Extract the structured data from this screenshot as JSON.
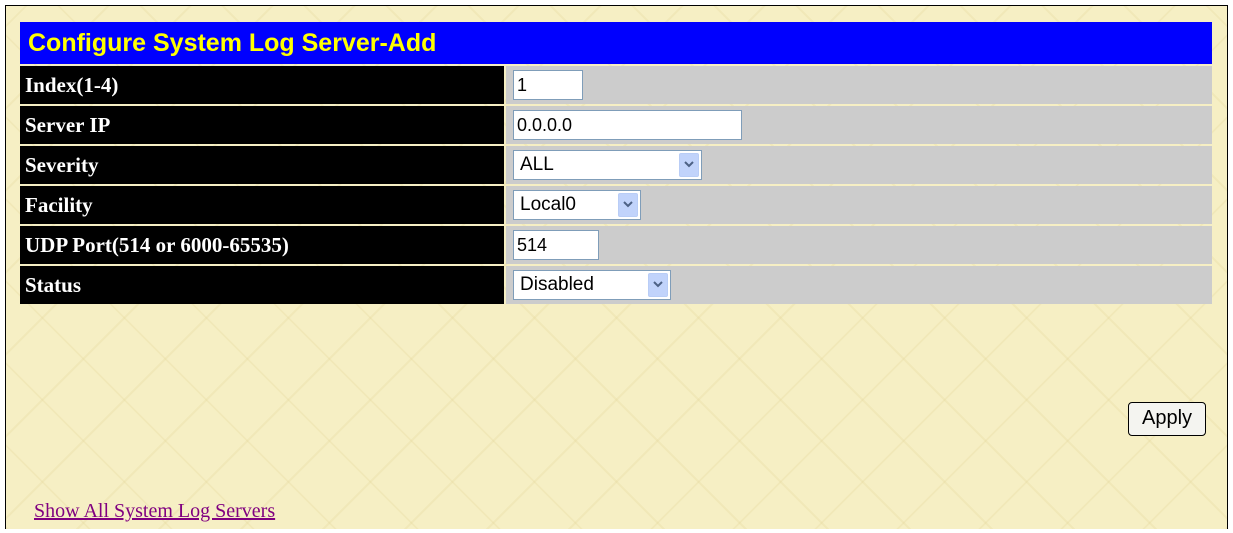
{
  "title": "Configure System Log Server-Add",
  "fields": [
    {
      "label": "Index(1-4)",
      "value": "1"
    },
    {
      "label": "Server IP",
      "value": "0.0.0.0"
    },
    {
      "label": "Severity",
      "value": "ALL"
    },
    {
      "label": "Facility",
      "value": "Local0"
    },
    {
      "label": "UDP Port(514 or 6000-65535)",
      "value": "514"
    },
    {
      "label": "Status",
      "value": "Disabled"
    }
  ],
  "apply_label": "Apply",
  "show_all_link": "Show All System Log Servers",
  "colors": {
    "title_bg": "#0000fe",
    "title_text": "#ffff00",
    "label_bg": "#000000",
    "label_text": "#ffffff",
    "value_bg": "#cccccc",
    "page_bg": "#f6efc4",
    "link": "#800080"
  }
}
